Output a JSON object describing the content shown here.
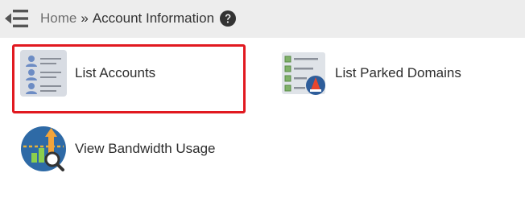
{
  "breadcrumb": {
    "home_label": "Home",
    "separator": "»",
    "current_label": "Account Information"
  },
  "tiles": [
    {
      "label": "List Accounts",
      "icon": "list-accounts-icon",
      "highlighted": true
    },
    {
      "label": "List Parked Domains",
      "icon": "parked-domains-icon",
      "highlighted": false
    },
    {
      "label": "View Bandwidth Usage",
      "icon": "bandwidth-usage-icon",
      "highlighted": false
    }
  ],
  "colors": {
    "breadcrumb_background": "#ededed",
    "highlight_border": "#e11920",
    "text": "#2d2d2d",
    "muted_text": "#6f6f6f"
  }
}
